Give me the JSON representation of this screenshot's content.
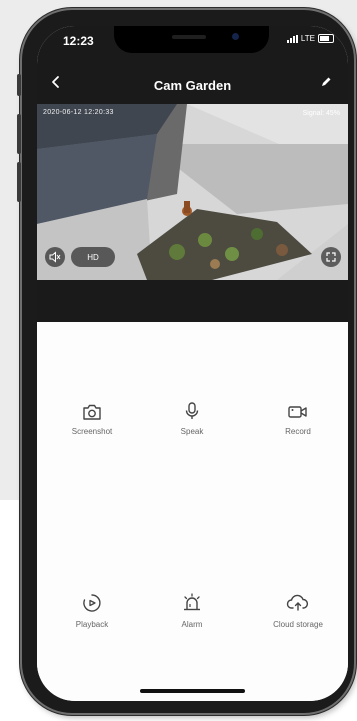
{
  "status_bar": {
    "time": "12:23",
    "network": "LTE"
  },
  "header": {
    "title": "Cam Garden",
    "back_icon": "chevron-left-icon",
    "edit_icon": "pencil-icon"
  },
  "video": {
    "timestamp": "2020-06-12 12:20:33",
    "signal_label": "Signal: 45%",
    "quality_label": "HD"
  },
  "controls": [
    {
      "label": "Screenshot",
      "icon": "camera-icon"
    },
    {
      "label": "Speak",
      "icon": "microphone-icon"
    },
    {
      "label": "Record",
      "icon": "video-camera-icon"
    },
    {
      "label": "Playback",
      "icon": "playback-icon"
    },
    {
      "label": "Alarm",
      "icon": "alarm-icon"
    },
    {
      "label": "Cloud storage",
      "icon": "cloud-upload-icon"
    }
  ],
  "colors": {
    "header_bg": "#1a1a1a",
    "icon": "#444444",
    "label": "#666666"
  }
}
